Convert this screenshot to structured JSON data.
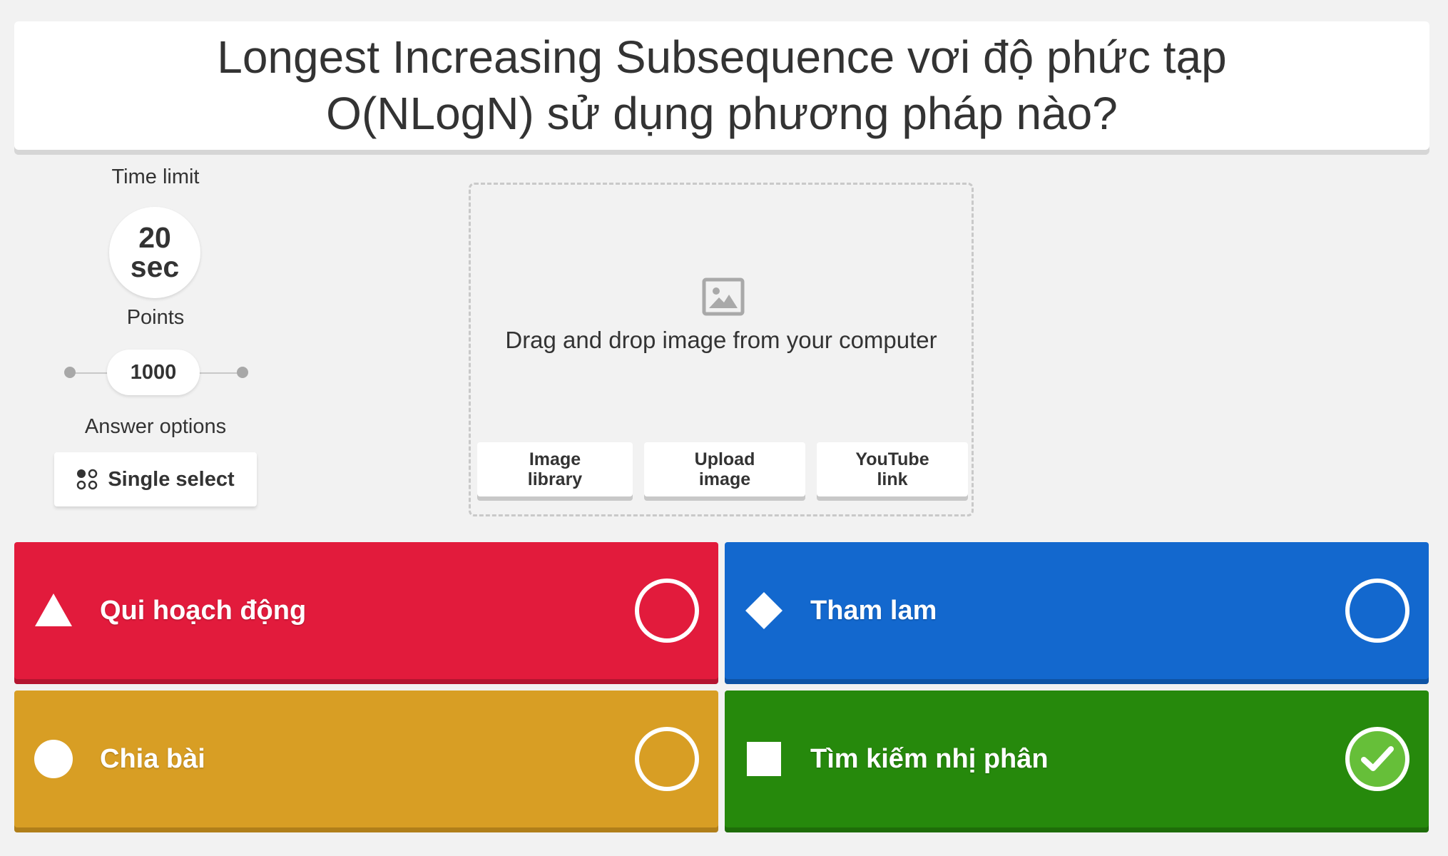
{
  "question": {
    "line1": "Longest Increasing Subsequence vơi độ phức tạp",
    "line2": "O(NLogN) sử dụng phương pháp nào?"
  },
  "sidebar": {
    "time_limit_label": "Time limit",
    "time_value": "20",
    "time_unit": "sec",
    "points_label": "Points",
    "points_value": "1000",
    "answer_options_label": "Answer options",
    "answer_options_value": "Single select"
  },
  "media": {
    "drop_text": "Drag and drop image from your computer",
    "buttons": [
      {
        "line1": "Image",
        "line2": "library"
      },
      {
        "line1": "Upload",
        "line2": "image"
      },
      {
        "line1": "YouTube",
        "line2": "link"
      }
    ]
  },
  "answers": [
    {
      "text": "Qui hoạch động",
      "shape": "triangle-icon",
      "color": "#e21b3c",
      "correct": false
    },
    {
      "text": "Tham lam",
      "shape": "diamond-icon",
      "color": "#1368ce",
      "correct": false
    },
    {
      "text": "Chia bài",
      "shape": "circle-icon",
      "color": "#d89e24",
      "correct": false
    },
    {
      "text": "Tìm kiếm nhị phân",
      "shape": "square-icon",
      "color": "#26890c",
      "correct": true
    }
  ]
}
